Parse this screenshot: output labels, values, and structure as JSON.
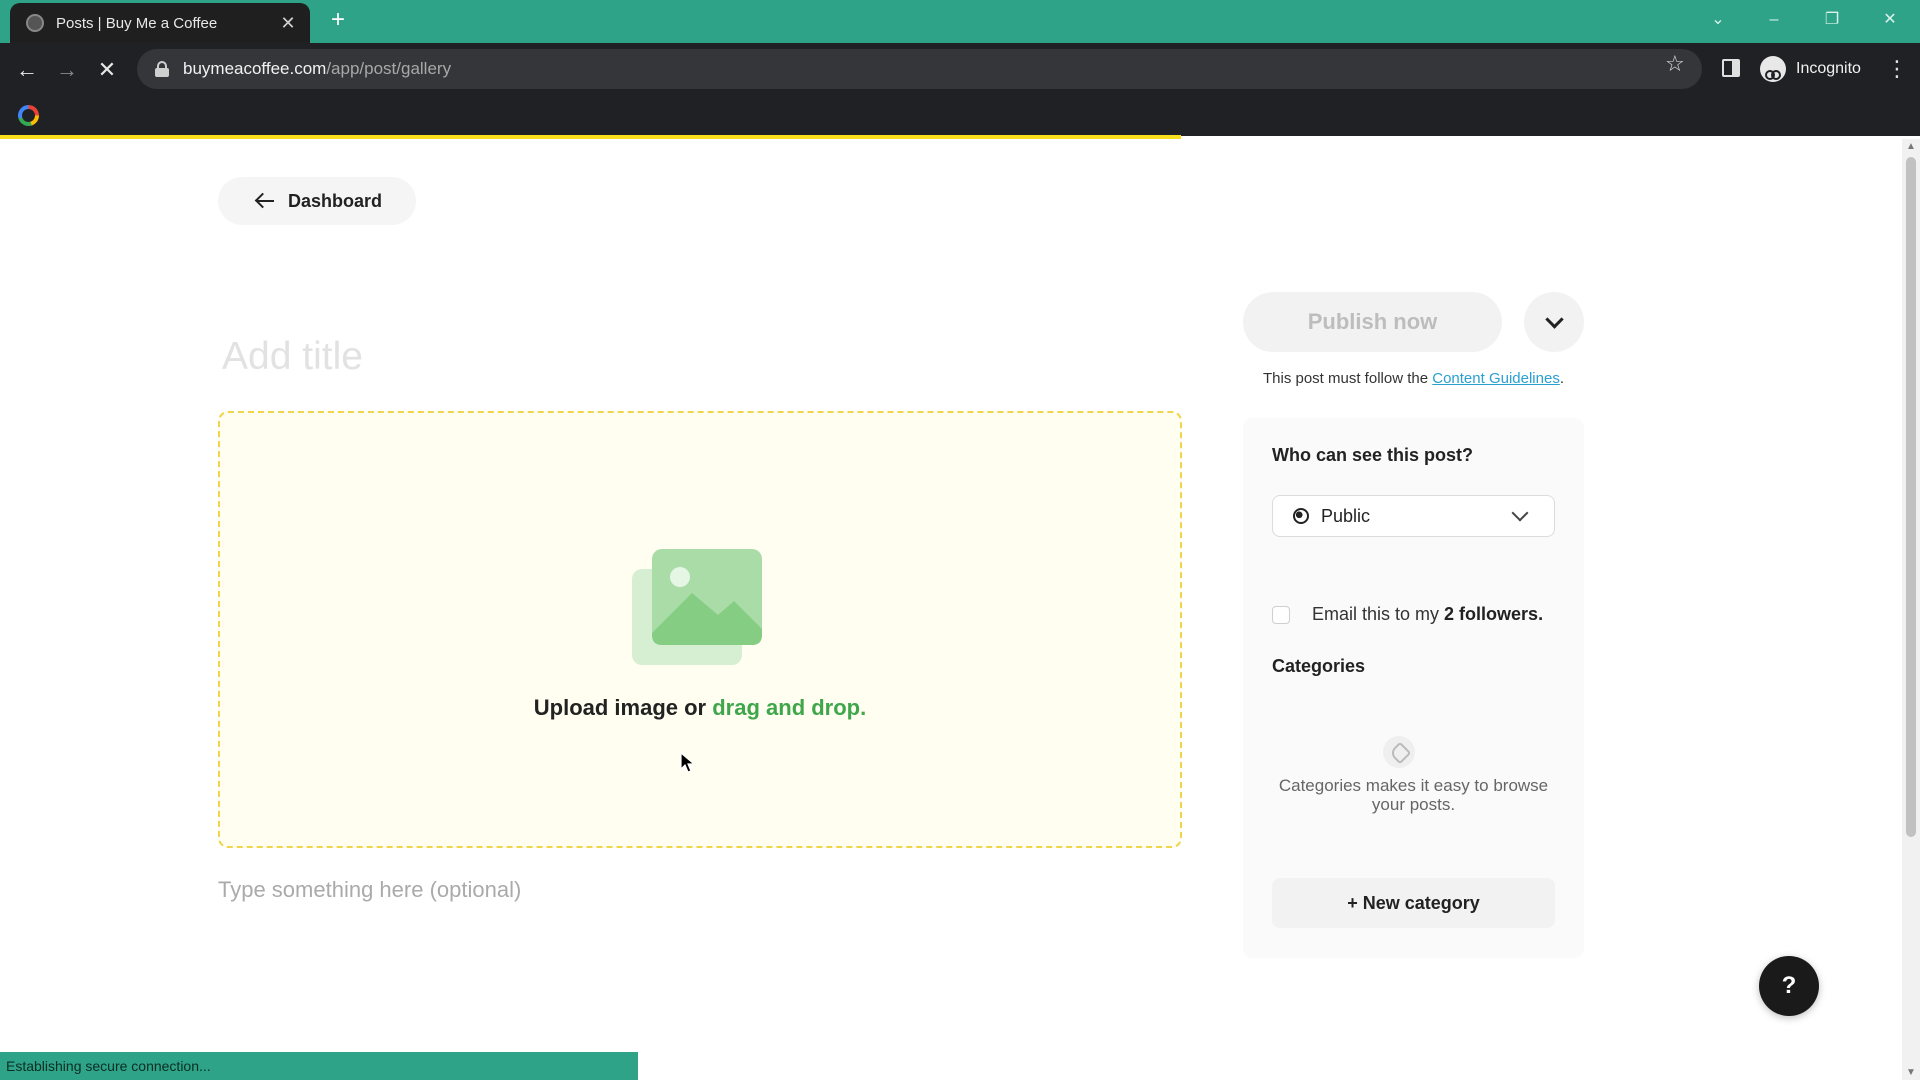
{
  "browser": {
    "tab_title": "Posts | Buy Me a Coffee",
    "url_host": "buymeacoffee.com",
    "url_path": "/app/post/gallery",
    "profile_label": "Incognito",
    "status_text": "Establishing secure connection...",
    "load_progress": 0.615
  },
  "page": {
    "back_label": "Dashboard",
    "title_placeholder": "Add title",
    "upload": {
      "prefix": "Upload image or",
      "accent": "drag and drop."
    },
    "body_placeholder": "Type something here (optional)"
  },
  "sidebar": {
    "publish_label": "Publish now",
    "guideline_prefix": "This post must follow the",
    "guideline_link": "Content Guidelines",
    "guideline_suffix": ".",
    "visibility_heading": "Who can see this post?",
    "visibility_value": "Public",
    "email_prefix": "Email this to my",
    "email_count": "2 followers.",
    "categories_heading": "Categories",
    "categories_hint": "Categories makes it easy to browse your posts.",
    "new_category_label": "+ New category"
  },
  "help_label": "?",
  "colors": {
    "chrome_accent": "#2ea388",
    "progress": "#f7df1e",
    "upload_border": "#f0d44a",
    "upload_accent": "#3fa64b",
    "link": "#2a9fd0"
  }
}
